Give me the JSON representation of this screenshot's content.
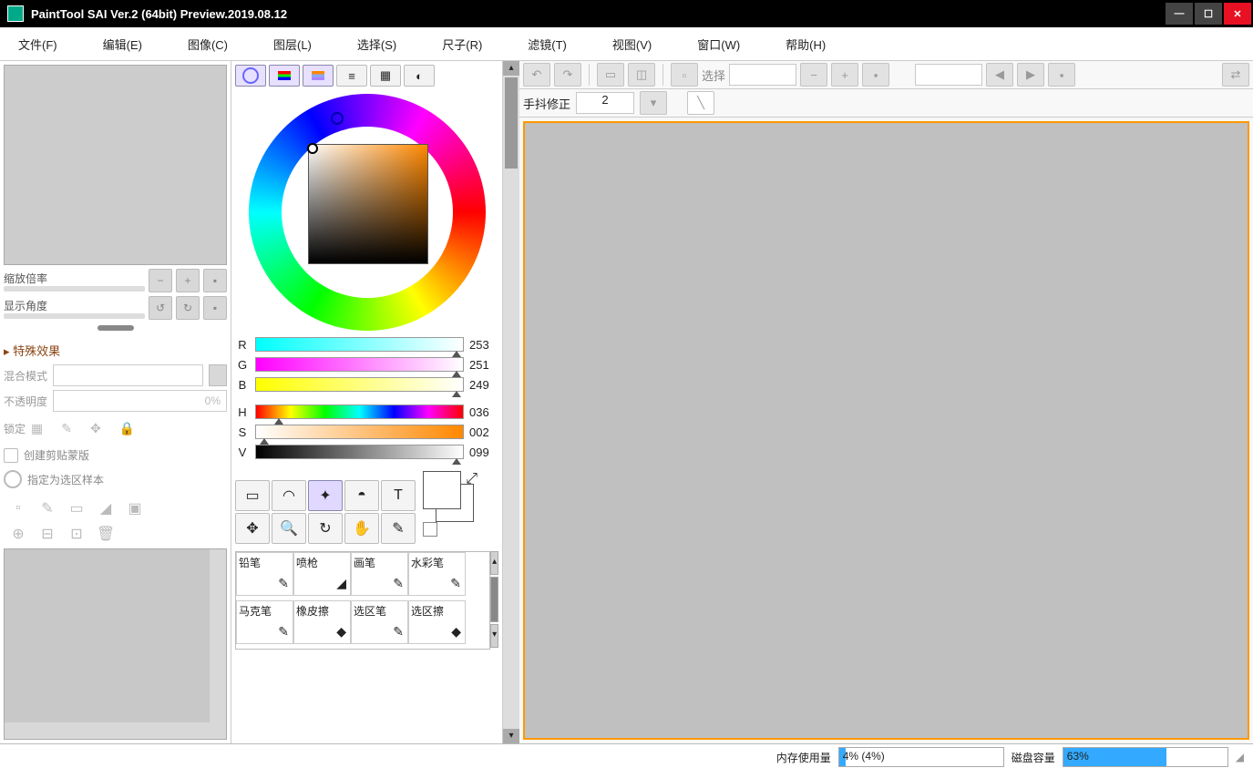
{
  "title": "PaintTool SAI Ver.2 (64bit) Preview.2019.08.12",
  "menus": [
    "文件(F)",
    "编辑(E)",
    "图像(C)",
    "图层(L)",
    "选择(S)",
    "尺子(R)",
    "滤镜(T)",
    "视图(V)",
    "窗口(W)",
    "帮助(H)"
  ],
  "nav": {
    "zoom_label": "缩放倍率",
    "angle_label": "显示角度"
  },
  "fx_header": "特殊效果",
  "props": {
    "blend_label": "混合模式",
    "opacity_label": "不透明度",
    "opacity_value": "0%",
    "lock_label": "锁定",
    "clip_mask": "创建剪贴蒙版",
    "sel_source": "指定为选区样本"
  },
  "rgb": {
    "R": "253",
    "G": "251",
    "B": "249",
    "H": "036",
    "S": "002",
    "V": "099"
  },
  "brushes": [
    "铅笔",
    "喷枪",
    "画笔",
    "水彩笔",
    "马克笔",
    "橡皮擦",
    "选区笔",
    "选区擦"
  ],
  "toolbar": {
    "select_label": "选择",
    "stabilizer_label": "手抖修正",
    "stabilizer_value": "2"
  },
  "status": {
    "mem_label": "内存使用量",
    "mem_text": "4% (4%)",
    "mem_pct": 4,
    "disk_label": "磁盘容量",
    "disk_text": "63%",
    "disk_pct": 63
  }
}
